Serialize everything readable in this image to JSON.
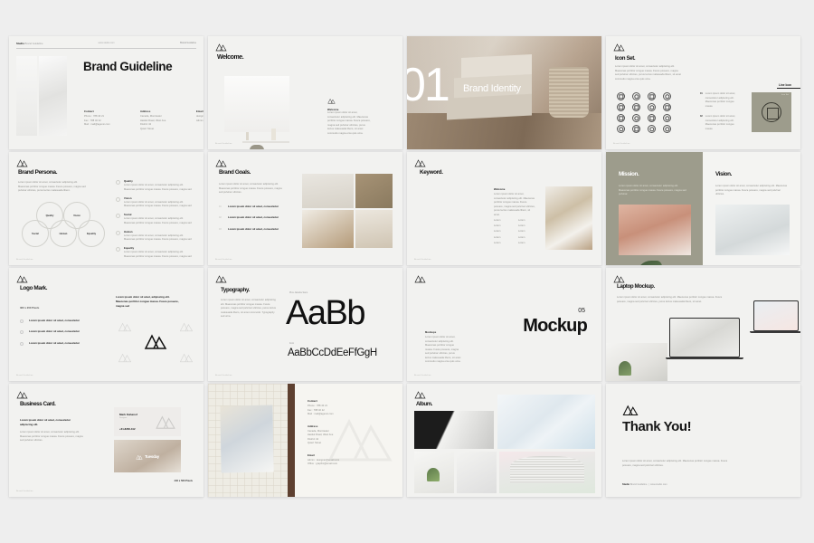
{
  "page": {
    "background": "#eeeeee",
    "accent_olive": "#9d9c8c",
    "ink": "#141414"
  },
  "lorem": {
    "short": "Lorem ipsum dolor sit amet, consectetur adipiscing elit. Maecenas porttitor congue massa.",
    "medium": "Lorem ipsum dolor sit amet, consectetur adipiscing elit. Maecenas porttitor congue massa. Fusce posuere, magna sed pulvinar ultricies, purus lectus malesuada libero.",
    "long": "Lorem ipsum dolor sit amet, consectetur adipiscing elit. Maecenas porttitor congue massa. Fusce posuere, magna sed pulvinar ultricies, purus lectus malesuada libero, sit amet commodo magna eros quis urna.",
    "item": "Lorem ipsum dolor sit amet, consectetur",
    "word": "Lorem"
  },
  "slides": [
    {
      "id": "brand-guideline",
      "header_left": "Studio",
      "header_left_sub": "Brand Guideline",
      "header_center": "www.studio.com",
      "header_right": "Brand Guideline",
      "title": "Brand Guideline",
      "columns": [
        {
          "label": "Contact",
          "lines": [
            "Phone : 788 40 21",
            "Fax : 788 40 22",
            "",
            "Mail : mail@agensi.com"
          ]
        },
        {
          "label": "Address",
          "lines": [
            "Canada, Montrealer",
            "Haiduk Road, West Ave",
            "District 42",
            "Qwert Street"
          ]
        },
        {
          "label": "Email",
          "lines": [
            "designer.graphic@email.com",
            "",
            "Admin : graphic@email.com"
          ]
        }
      ]
    },
    {
      "id": "welcome",
      "title": "Welcome.",
      "caption_label": "Welcome",
      "caption_body": "Lorem ipsum dolor sit amet, consectetur adipiscing elit. Maecenas porttitor congue massa. Fusce posuere, magna sed pulvinar ultricies, purus lectus malesuada libero, sit amet commodo magna eros quis urna."
    },
    {
      "id": "brand-identity-divider",
      "number": "01",
      "title": "Brand Identity"
    },
    {
      "id": "icon-set",
      "title": "Icon Set.",
      "body": "Lorem ipsum dolor sit amet, consectetur adipiscing elit. Maecenas porttitor congue massa. Fusce posuere, magna sed pulvinar ultricies, purus lectus malesuada libero, sit amet commodo magna eros quis urna.",
      "line_icon_label": "Line Icon",
      "icon_names": [
        "target-icon",
        "search-icon",
        "compass-icon",
        "check-circle-icon",
        "rss-icon",
        "book-icon",
        "clock-circle-icon",
        "calendar-icon",
        "camera-icon",
        "clock-icon",
        "scissors-icon",
        "settings-icon",
        "refresh-icon",
        "grid-icon",
        "info-icon",
        "minus-circle-icon"
      ],
      "notes": [
        {
          "num": "01",
          "text": "Lorem ipsum dolor sit amet, consectetur adipiscing elit. Maecenas porttitor congue massa"
        },
        {
          "num": "02",
          "text": "Lorem ipsum dolor sit amet, consectetur adipiscing elit. Maecenas porttitor congue massa"
        }
      ],
      "swatch_tag": "Icon Set"
    },
    {
      "id": "brand-persona",
      "title": "Brand Persona.",
      "body": "Lorem ipsum dolor sit amet, consectetur adipiscing elit. Maecenas porttitor congue massa. Fusce posuere, magna sed pulvinar ultricies, purus lectus malesuada libero.",
      "venn": [
        "Quality",
        "Vision",
        "Social",
        "Human",
        "Equality"
      ],
      "items": [
        {
          "label": "Quality",
          "text": "Lorem ipsum dolor sit amet, consectetur adipiscing elit. Maecenas porttitor congue massa. Fusce posuere, magna sed"
        },
        {
          "label": "Vision",
          "text": "Lorem ipsum dolor sit amet, consectetur adipiscing elit. Maecenas porttitor congue massa. Fusce posuere, magna sed"
        },
        {
          "label": "Social",
          "text": "Lorem ipsum dolor sit amet, consectetur adipiscing elit. Maecenas porttitor congue massa. Fusce posuere, magna sed"
        },
        {
          "label": "Human",
          "text": "Lorem ipsum dolor sit amet, consectetur adipiscing elit. Maecenas porttitor congue massa. Fusce posuere, magna sed"
        },
        {
          "label": "Equality",
          "text": "Lorem ipsum dolor sit amet, consectetur adipiscing elit. Maecenas porttitor congue massa. Fusce posuere, magna sed"
        }
      ]
    },
    {
      "id": "brand-goals",
      "title": "Brand Goals.",
      "body": "Lorem ipsum dolor sit amet, consectetur adipiscing elit. Maecenas porttitor congue massa. Fusce posuere, magna sed pulvinar ultricies.",
      "steps": [
        {
          "num": "01",
          "text": "Lorem ipsum dolor sit amet, consectetur"
        },
        {
          "num": "02",
          "text": "Lorem ipsum dolor sit amet, consectetur"
        },
        {
          "num": "03",
          "text": "Lorem ipsum dolor sit amet, consectetur"
        }
      ]
    },
    {
      "id": "keyword",
      "title": "Keyword.",
      "block_label": "Welcome",
      "block_body": "Lorem ipsum dolor sit amet, consectetur adipiscing elit. Maecenas porttitor congue massa. Fusce posuere, magna sed pulvinar ultricies, purus lectus malesuada libero, sit amet.",
      "keywords": [
        "Lorem",
        "Lorem",
        "Lorem",
        "Lorem",
        "Lorem",
        "Lorem",
        "Lorem",
        "Lorem",
        "Lorem",
        "Lorem"
      ]
    },
    {
      "id": "mission-vision",
      "mission_title": "Mission.",
      "mission_body": "Lorem ipsum dolor sit amet, consectetur adipiscing elit. Maecenas porttitor congue massa. Fusce posuere, magna sed pulvinar.",
      "vision_title": "Vision.",
      "vision_body": "Lorem ipsum dolor sit amet, consectetur adipiscing elit. Maecenas porttitor congue massa. Fusce posuere, magna sed pulvinar ultricies."
    },
    {
      "id": "logo-mark",
      "title": "Logo Mark.",
      "dimension": "360 x 200 Pixels",
      "steps": [
        "Lorem ipsum dolor sit amet, consectetur",
        "Lorem ipsum dolor sit amet, consectetur",
        "Lorem ipsum dolor sit amet, consectetur"
      ],
      "right_text": "Lorem ipsum dolor sit amet, adipiscing elit. Maecenas porttitor congue massa. Fusce posuere, magna sed"
    },
    {
      "id": "typography",
      "title": "Typography.",
      "body": "Lorem ipsum dolor sit amet, consectetur adipiscing elit. Maecenas porttitor congue massa. Fusce posuere, magna sed pulvinar ultricies, purus lectus malesuada libero, sit amet commodo. Typography sed urna.",
      "kicker_primary": "Plus Jakarta Sans.",
      "specimen_big": "AaBb",
      "kicker_secondary": "Font",
      "specimen_alphabet": "AaBbCcDdEeFfGgH"
    },
    {
      "id": "mockup-divider",
      "number": "05",
      "title": "Mockup",
      "caption_label": "Mockups",
      "caption_body": "Lorem ipsum dolor sit amet, consectetur adipiscing elit. Maecenas porttitor congue massa. Fusce posuere, magna sed pulvinar ultricies, purus lectus malesuada libero, sit amet commodo magna eros quis urna."
    },
    {
      "id": "laptop-mockup",
      "title": "Laptop Mockup.",
      "body": "Lorem ipsum dolor sit amet, consectetur adipiscing elit. Maecenas porttitor congue massa. Fusce posuere, magna sed pulvinar ultricies, purus lectus malesuada libero, sit amet."
    },
    {
      "id": "business-card",
      "title": "Business Card.",
      "lead": "Lorem ipsum dolor sit amet, consectetur adipiscing elit.",
      "body": "Lorem ipsum dolor sit amet, consectetur adipiscing elit. Maecenas porttitor congue massa. Fusce posuere, magna sed pulvinar ultricies.",
      "card_name": "Mark Kahanof",
      "card_role": "Designer",
      "card_phone": "+61-8266-312",
      "card_brand": "Tuesday",
      "dimension": "440 x 560 Pixels"
    },
    {
      "id": "contact-grid",
      "sections": [
        {
          "label": "Contact",
          "lines": [
            "Phone : 788 40 21",
            "Fax : 788 40 22",
            "",
            "Mail : mail@agensi.com"
          ]
        },
        {
          "label": "Address",
          "lines": [
            "Canada, Montrealer",
            "Haiduk Road, West Ave",
            "District 42",
            "Qwert Street"
          ]
        },
        {
          "label": "Email",
          "lines": [
            "Admin : designer@email.com",
            "",
            "Office : graphic@email.com"
          ]
        }
      ]
    },
    {
      "id": "album",
      "title": "Album."
    },
    {
      "id": "thank-you",
      "title": "Thank You!",
      "body": "Lorem ipsum dolor sit amet, consectetur adipiscing elit. Maecenas porttitor congue massa. Fusce posuere, magna sed pulvinar ultricies.",
      "footer_brand": "Studio",
      "footer_sub": "Brand Guideline",
      "footer_site": "www.studio.com"
    }
  ]
}
